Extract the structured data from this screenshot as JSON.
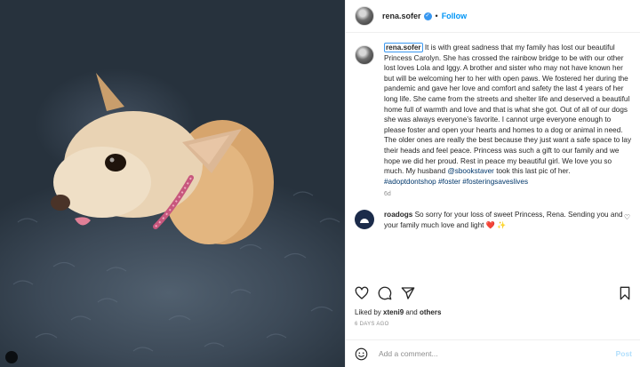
{
  "post": {
    "username": "rena.sofer",
    "verified_mark": "✓",
    "separator": "•",
    "follow_label": "Follow"
  },
  "caption": {
    "username": "rena.sofer",
    "text_part1": " It is with great sadness that my family has lost our beautiful Princess Carolyn. She has crossed the rainbow bridge to be with our other lost loves Lola and Iggy. A brother and sister who may not have known her but will be welcoming her to her with open paws. We fostered her during the pandemic and gave her love and comfort and safety the last 4 years of her long life. She came from the streets and shelter life and deserved a beautiful home full of warmth and love and that is what she got. Out of all of our dogs she was always everyone’s favorite. I cannot urge everyone enough to please foster and open your hearts and homes to a dog or animal in need. The older ones are really the best because they just want a safe space to lay their heads and feel peace. Princess was such a gift to our family and we hope we did her proud. Rest in peace my beautiful girl. We love you so much. My husband ",
    "mention": "@sbookstaver",
    "text_part2": " took this last pic of her.",
    "hashtags": "#adoptdontshop #foster #fosteringsaveslives",
    "age": "6d"
  },
  "comment": {
    "username": "roadogs",
    "text": " So sorry for your loss of sweet Princess, Rena. Sending you and your family much love and light ",
    "emoji": "❤️ ✨",
    "like_icon": "♡"
  },
  "likes": {
    "prefix": "Liked by ",
    "user": "xteni9",
    "middle": " and ",
    "others": "others"
  },
  "timestamp": "6 DAYS AGO",
  "add_comment": {
    "placeholder": "Add a comment...",
    "post_label": "Post"
  },
  "icons": {
    "header_avatar": "profile-avatar",
    "like": "heart-icon",
    "comment": "comment-bubble-icon",
    "share": "paper-plane-icon",
    "save": "bookmark-icon",
    "emoji": "smiley-icon"
  },
  "colors": {
    "link_blue": "#0095f6",
    "verified_blue": "#3897f0",
    "hashtag_blue": "#00376b",
    "muted_gray": "#8e8e8e"
  }
}
